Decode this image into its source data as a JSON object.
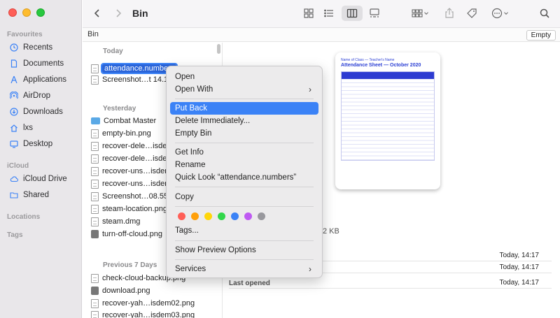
{
  "window": {
    "title": "Bin"
  },
  "sidebar": {
    "sections": [
      {
        "label": "Favourites"
      },
      {
        "label": "iCloud"
      },
      {
        "label": "Locations"
      },
      {
        "label": "Tags"
      }
    ],
    "favourites": [
      {
        "label": "Recents",
        "icon": "clock-icon"
      },
      {
        "label": "Documents",
        "icon": "document-icon"
      },
      {
        "label": "Applications",
        "icon": "applications-icon"
      },
      {
        "label": "AirDrop",
        "icon": "airdrop-icon"
      },
      {
        "label": "Downloads",
        "icon": "download-icon"
      },
      {
        "label": "lxs",
        "icon": "home-icon"
      },
      {
        "label": "Desktop",
        "icon": "desktop-icon"
      }
    ],
    "icloud": [
      {
        "label": "iCloud Drive",
        "icon": "cloud-icon"
      },
      {
        "label": "Shared",
        "icon": "shared-folder-icon"
      }
    ]
  },
  "pathbar": {
    "label": "Bin",
    "empty_button": "Empty"
  },
  "files": {
    "groups": {
      "today": "Today",
      "yesterday": "Yesterday",
      "previous7": "Previous 7 Days"
    },
    "today": [
      "attendance.numbers",
      "Screenshot…t 14.1"
    ],
    "yesterday": [
      "Combat Master",
      "empty-bin.png",
      "recover-dele…isdem",
      "recover-dele…isdem",
      "recover-uns…isdem",
      "recover-uns…isdem",
      "Screenshot…08.55",
      "steam-location.png",
      "steam.dmg",
      "turn-off-cloud.png"
    ],
    "previous7": [
      "check-cloud-backup.png",
      "download.png",
      "recover-yah…isdem02.png",
      "recover-yah…isdem03.png"
    ]
  },
  "preview": {
    "sheet_header": "Name of Class — Teacher's Name",
    "sheet_title": "Attendance Sheet — October 2020",
    "size_text": "2 KB",
    "dates": [
      "Today, 14:17",
      "Today, 14:17",
      "Today, 14:17"
    ],
    "last_opened_label": "Last opened"
  },
  "context_menu": {
    "items": [
      "Open",
      "Open With",
      "Put Back",
      "Delete Immediately...",
      "Empty Bin",
      "Get Info",
      "Rename",
      "Quick Look “attendance.numbers”",
      "Copy",
      "Tags...",
      "Show Preview Options",
      "Services"
    ],
    "highlighted": "Put Back",
    "tag_colors": [
      "#ff5f57",
      "#ff9f0a",
      "#ffd60a",
      "#32d74b",
      "#3b82f6",
      "#bf5af2",
      "#98989d"
    ]
  },
  "colors": {
    "accent": "#3b82f6",
    "selection": "#2a64d9"
  }
}
